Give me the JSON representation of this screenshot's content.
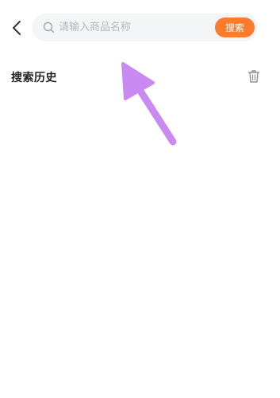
{
  "header": {
    "back_icon": "chevron-left-icon",
    "search": {
      "placeholder": "请输入商品名称",
      "value": "",
      "icon": "search-icon"
    },
    "search_button_label": "搜索"
  },
  "history": {
    "title": "搜索历史",
    "clear_icon": "trash-icon",
    "items": []
  },
  "colors": {
    "accent": "#ff7a2a",
    "annotation_arrow": "#c98bf2",
    "search_bg": "#f4f5f7"
  }
}
